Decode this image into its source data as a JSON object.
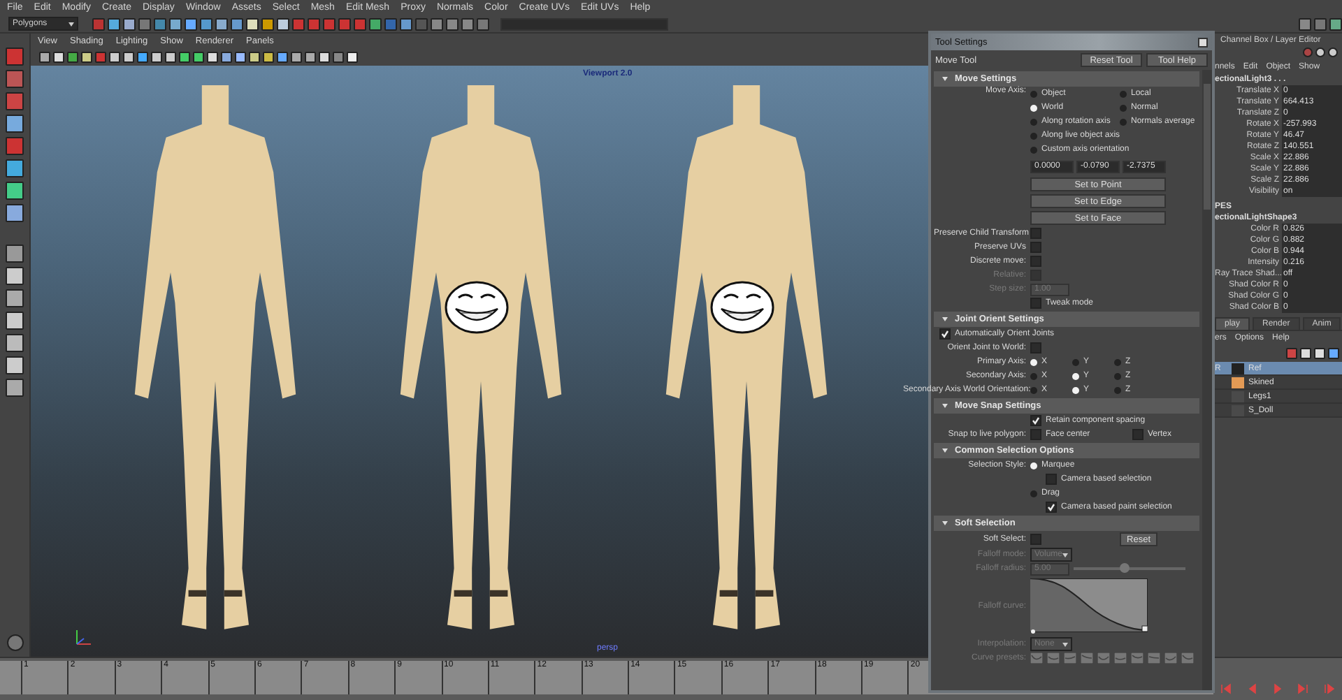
{
  "menu_bar": [
    "File",
    "Edit",
    "Modify",
    "Create",
    "Display",
    "Window",
    "Assets",
    "Select",
    "Mesh",
    "Edit Mesh",
    "Proxy",
    "Normals",
    "Color",
    "Create UVs",
    "Edit UVs",
    "Help"
  ],
  "menu_set": "Polygons",
  "viewport": {
    "menu": [
      "View",
      "Shading",
      "Lighting",
      "Show",
      "Renderer",
      "Panels"
    ],
    "renderer_label": "Viewport 2.0",
    "camera_label": "persp",
    "figures": [
      {
        "censored": false
      },
      {
        "censored": true
      },
      {
        "censored": true
      }
    ]
  },
  "tool_settings": {
    "title": "Tool Settings",
    "tool": "Move Tool",
    "buttons": [
      "Reset Tool",
      "Tool Help"
    ],
    "sections": [
      {
        "title": "Move Settings",
        "expanded": true,
        "rows": [
          {
            "kind": "radio_columns",
            "label": "Move Axis:",
            "columns": [
              [
                {
                  "label": "Object",
                  "selected": false
                },
                {
                  "label": "World",
                  "selected": true
                },
                {
                  "label": "Along rotation axis",
                  "selected": false
                },
                {
                  "label": "Along live object axis",
                  "selected": false
                },
                {
                  "label": "Custom axis orientation",
                  "selected": false
                }
              ],
              [
                {
                  "label": "Local",
                  "selected": false
                },
                {
                  "label": "Normal",
                  "selected": false
                },
                {
                  "label": "Normals average",
                  "selected": false
                }
              ]
            ]
          },
          {
            "kind": "fields",
            "values": [
              "0.0000",
              "-0.0790",
              "-2.7375"
            ]
          },
          {
            "kind": "button",
            "label": "Set to Point"
          },
          {
            "kind": "button",
            "label": "Set to Edge"
          },
          {
            "kind": "button",
            "label": "Set to Face"
          },
          {
            "kind": "check",
            "label": "Preserve Child Transform",
            "checked": false,
            "disabled": false
          },
          {
            "kind": "check",
            "label": "Preserve UVs",
            "checked": false,
            "disabled": false
          },
          {
            "kind": "check",
            "label": "Discrete move:",
            "checked": false,
            "disabled": false
          },
          {
            "kind": "check",
            "label": "Relative:",
            "checked": false,
            "disabled": true
          },
          {
            "kind": "field",
            "label": "Step size:",
            "value": "1.00",
            "disabled": true
          },
          {
            "kind": "check",
            "text": "Tweak mode",
            "checked": false,
            "disabled": false
          }
        ]
      },
      {
        "title": "Joint Orient Settings",
        "expanded": true,
        "rows": [
          {
            "kind": "check_left",
            "text": "Automatically Orient Joints",
            "checked": true,
            "disabled": false
          },
          {
            "kind": "check",
            "label": "Orient Joint to World:",
            "checked": false,
            "disabled": false
          },
          {
            "kind": "radio_inline",
            "label": "Primary Axis:",
            "options": [
              {
                "label": "X",
                "selected": true
              },
              {
                "label": "Y",
                "selected": false
              },
              {
                "label": "Z",
                "selected": false
              }
            ]
          },
          {
            "kind": "radio_inline",
            "label": "Secondary Axis:",
            "options": [
              {
                "label": "X",
                "selected": false
              },
              {
                "label": "Y",
                "selected": true
              },
              {
                "label": "Z",
                "selected": false
              }
            ]
          },
          {
            "kind": "radio_inline",
            "label": "Secondary Axis World Orientation:",
            "options": [
              {
                "label": "X",
                "selected": false
              },
              {
                "label": "Y",
                "selected": true
              },
              {
                "label": "Z",
                "selected": false
              }
            ]
          }
        ]
      },
      {
        "title": "Move Snap Settings",
        "expanded": true,
        "rows": [
          {
            "kind": "check",
            "text": "Retain component spacing",
            "checked": true,
            "disabled": false
          },
          {
            "kind": "checks",
            "label": "Snap to live polygon:",
            "items": [
              {
                "text": "Face center",
                "checked": false
              },
              {
                "text": "Vertex",
                "checked": false
              }
            ]
          }
        ]
      },
      {
        "title": "Common Selection Options",
        "expanded": true,
        "rows": [
          {
            "kind": "radio",
            "label": "Selection Style:",
            "text": "Marquee",
            "selected": true,
            "children": [
              {
                "text": "Camera based selection",
                "checked": false
              }
            ]
          },
          {
            "kind": "radio",
            "text": "Drag",
            "selected": false,
            "children": [
              {
                "text": "Camera based paint selection",
                "checked": true
              }
            ]
          }
        ]
      },
      {
        "title": "Soft Selection",
        "expanded": true,
        "rows": [
          {
            "kind": "check_button",
            "label": "Soft Select:",
            "checked": false,
            "button": "Reset"
          },
          {
            "kind": "dropdown",
            "label": "Falloff mode:",
            "value": "Volume",
            "disabled": true
          },
          {
            "kind": "slider",
            "label": "Falloff radius:",
            "value": "5.00",
            "level": 0.45,
            "disabled": true
          },
          {
            "kind": "curve",
            "label": "Falloff curve:"
          },
          {
            "kind": "dropdown",
            "label": "Interpolation:",
            "value": "None",
            "disabled": true
          },
          {
            "kind": "presets",
            "label": "Curve presets:"
          }
        ]
      }
    ]
  },
  "channel_box": {
    "title": "Channel Box / Layer Editor",
    "menu": [
      "nnels",
      "Edit",
      "Object",
      "Show"
    ],
    "node": "ectionalLight3 . . .",
    "attributes": [
      {
        "name": "Translate X",
        "value": "0"
      },
      {
        "name": "Translate Y",
        "value": "664.413"
      },
      {
        "name": "Translate Z",
        "value": "0"
      },
      {
        "name": "Rotate X",
        "value": "-257.993"
      },
      {
        "name": "Rotate Y",
        "value": "46.47"
      },
      {
        "name": "Rotate Z",
        "value": "140.551"
      },
      {
        "name": "Scale X",
        "value": "22.886"
      },
      {
        "name": "Scale Y",
        "value": "22.886"
      },
      {
        "name": "Scale Z",
        "value": "22.886"
      },
      {
        "name": "Visibility",
        "value": "on"
      }
    ],
    "shapes_heading": "PES",
    "shape": "ectionalLightShape3",
    "shape_attributes": [
      {
        "name": "Color R",
        "value": "0.826"
      },
      {
        "name": "Color G",
        "value": "0.882"
      },
      {
        "name": "Color B",
        "value": "0.944"
      },
      {
        "name": "Intensity",
        "value": "0.216"
      },
      {
        "name": "Ray Trace Shad...",
        "value": "off"
      },
      {
        "name": "Shad Color R",
        "value": "0"
      },
      {
        "name": "Shad Color G",
        "value": "0"
      },
      {
        "name": "Shad Color B",
        "value": "0"
      }
    ]
  },
  "layer_editor": {
    "tabs": [
      {
        "label": "play",
        "selected": true
      },
      {
        "label": "Render",
        "selected": false
      },
      {
        "label": "Anim",
        "selected": false
      }
    ],
    "menu": [
      "ers",
      "Options",
      "Help"
    ],
    "layers": [
      {
        "name": "Ref",
        "display": "R",
        "selected": true,
        "color": "#222222"
      },
      {
        "name": "Skined",
        "selected": false,
        "color": "#e39a55"
      },
      {
        "name": "Legs1",
        "selected": false,
        "color": "#4a4a4a"
      },
      {
        "name": "S_Doll",
        "selected": false,
        "color": "#4a4a4a"
      }
    ]
  },
  "timeline": {
    "frames": [
      "1",
      "2",
      "3",
      "4",
      "5",
      "6",
      "7",
      "8",
      "9",
      "10",
      "11",
      "12",
      "13",
      "14",
      "15",
      "16",
      "17",
      "18",
      "19",
      "20"
    ]
  }
}
